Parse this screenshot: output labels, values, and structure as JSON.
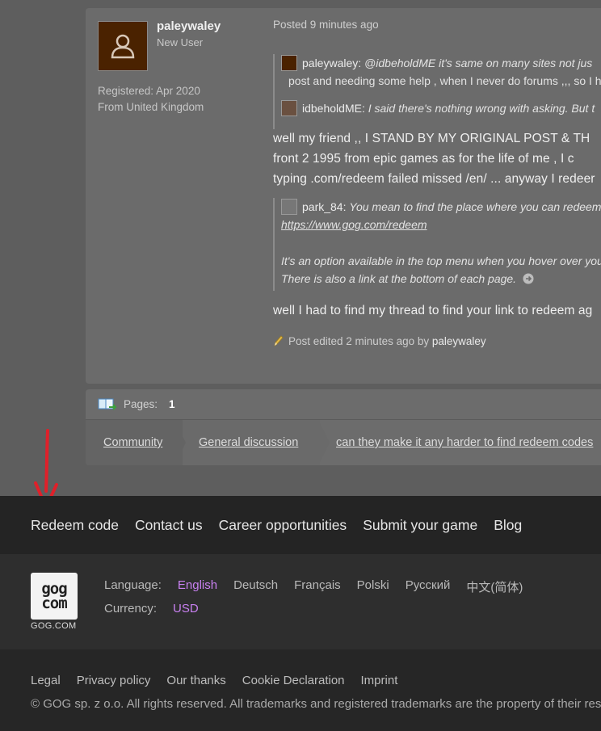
{
  "post": {
    "username": "paleywaley",
    "rank": "New User",
    "registered": "Registered: Apr 2020",
    "location": "From United Kingdom",
    "posted": "Posted 9 minutes ago",
    "quote1": {
      "line1_name": "paleywaley:",
      "line1_text": "@idbeholdME it's same on many sites not jus",
      "line2_text": "post and needing some help , when I never do forums ,,, so I hav",
      "line3_name": "idbeholdME:",
      "line3_text": "I said there's nothing wrong with asking. But t"
    },
    "body1": [
      "well my friend ,, I STAND BY MY ORIGINAL POST & TH",
      "front 2 1995 from epic games as for the life of me , I c",
      "typing .com/redeem failed missed /en/ ... anyway I redeer"
    ],
    "quote2": {
      "name": "park_84:",
      "line1_text": "You mean to find the place where you can redeem",
      "link": "https://www.gog.com/redeem",
      "line3_text": "It's an option available in the top menu when you hover over you",
      "line4_text": "There is also a link at the bottom of each page."
    },
    "body2": "well I had to find my thread to find your link to redeem ag",
    "edited_prefix": "Post edited 2 minutes ago by",
    "edited_by": "paleywaley"
  },
  "pager": {
    "label": "Pages:",
    "current": "1",
    "breadcrumbs": [
      "Community",
      "General discussion",
      "can they make it any harder to find redeem codes"
    ]
  },
  "footer": {
    "nav": [
      "Redeem code",
      "Contact us",
      "Career opportunities",
      "Submit your game",
      "Blog"
    ],
    "logo_caption": "GOG.COM",
    "language_label": "Language:",
    "languages": [
      "English",
      "Deutsch",
      "Français",
      "Polski",
      "Русский",
      "中文(简体)"
    ],
    "currency_label": "Currency:",
    "currency": "USD",
    "legal": [
      "Legal",
      "Privacy policy",
      "Our thanks",
      "Cookie Declaration",
      "Imprint"
    ],
    "copyright": "© GOG sp. z o.o. All rights reserved. All trademarks and registered trademarks are the property of their respe"
  },
  "colors": {
    "accent_selected": "#c880f0",
    "annotation_arrow": "#e0202a"
  }
}
